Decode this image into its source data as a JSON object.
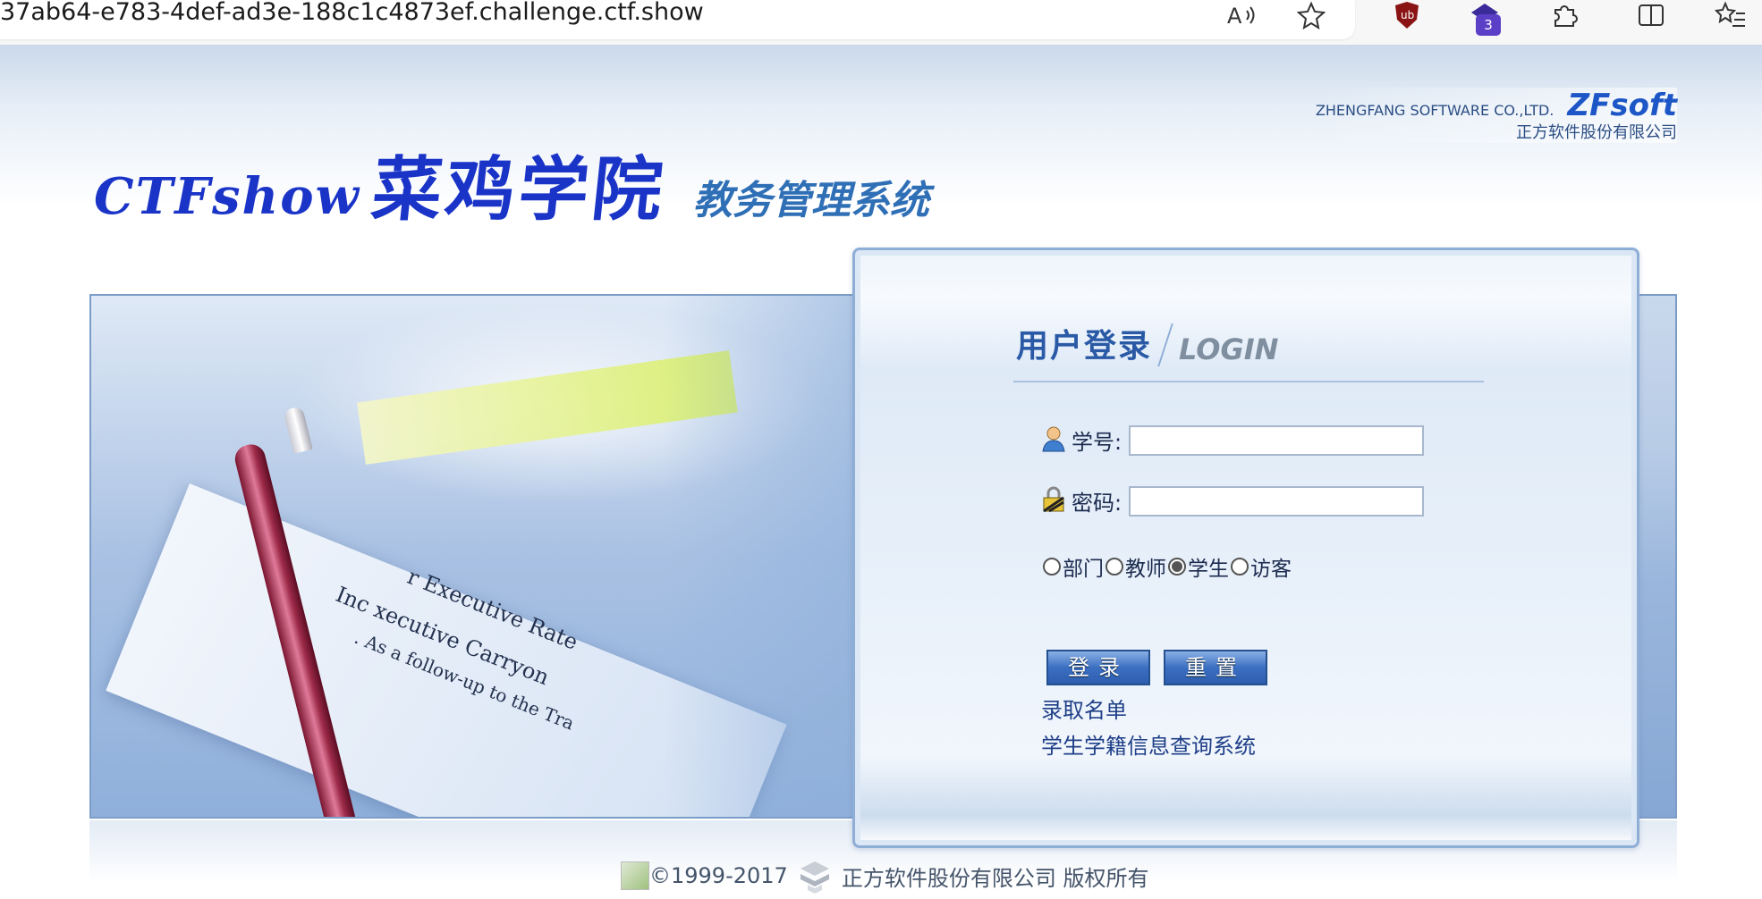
{
  "browser": {
    "url": "37ab64-e783-4def-ad3e-188c1c4873ef.challenge.ctf.show",
    "extension_badge": "3",
    "icons": [
      "read-aloud-icon",
      "favorite-star-icon",
      "ublock-icon",
      "extension-purple-icon",
      "extensions-puzzle-icon",
      "split-screen-icon",
      "favorites-list-icon"
    ]
  },
  "header": {
    "logo_en": "CTFshow",
    "logo_cn": "菜鸡学院",
    "system_name": "教务管理系统",
    "company_en": "ZHENGFANG SOFTWARE CO.,LTD.",
    "company_brand": "ZFsoft",
    "company_cn": "正方软件股份有限公司"
  },
  "login": {
    "title_cn": "用户登录",
    "title_en": "LOGIN",
    "username_label": "学号:",
    "password_label": "密码:",
    "username_value": "",
    "password_value": "",
    "roles": [
      {
        "label": "部门",
        "checked": false
      },
      {
        "label": "教师",
        "checked": false
      },
      {
        "label": "学生",
        "checked": true
      },
      {
        "label": "访客",
        "checked": false
      }
    ],
    "login_button": "登录",
    "reset_button": "重置",
    "link_admission": "录取名单",
    "link_student_status": "学生学籍信息查询系统"
  },
  "photo_text": {
    "line1": "r Executive Rate",
    "line2": "Inc   xecutive Carryon",
    "line3": ". As a follow-up to the Tra"
  },
  "footer": {
    "copyright": "©1999-2017",
    "company": "正方软件股份有限公司 版权所有"
  },
  "colors": {
    "brand_blue": "#1a34c8",
    "title_blue": "#2a5aa6",
    "link_blue": "#1f3f88",
    "button_blue": "#3b6fc2"
  }
}
